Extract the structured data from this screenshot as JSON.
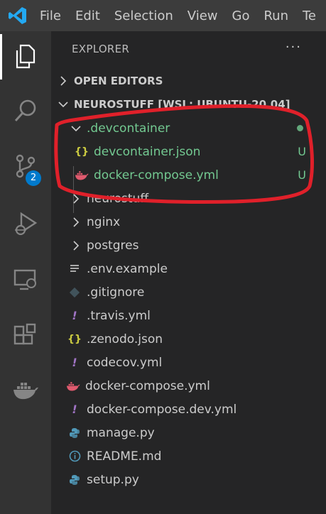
{
  "menu": [
    "File",
    "Edit",
    "Selection",
    "View",
    "Go",
    "Run",
    "Te"
  ],
  "activity": {
    "items": [
      "explorer-icon",
      "search-icon",
      "source-control-icon",
      "run-debug-icon",
      "remote-explorer-icon",
      "extensions-icon",
      "docker-icon"
    ],
    "scm_badge": "2"
  },
  "explorer": {
    "title": "EXPLORER",
    "more": "···",
    "open_editors": "OPEN EDITORS",
    "workspace": "NEUROSTUFF [WSL: UBUNTU-20.04]",
    "devcontainer": {
      "name": ".devcontainer",
      "children": [
        {
          "name": "devcontainer.json",
          "status": "U",
          "icon": "json-icon"
        },
        {
          "name": "docker-compose.yml",
          "status": "U",
          "icon": "docker-file-icon"
        }
      ]
    },
    "folders": [
      "neurostuff",
      "nginx",
      "postgres"
    ],
    "files": [
      {
        "name": ".env.example",
        "icon": "lines-icon"
      },
      {
        "name": ".gitignore",
        "icon": "git-icon"
      },
      {
        "name": ".travis.yml",
        "icon": "yaml-icon"
      },
      {
        "name": ".zenodo.json",
        "icon": "json-icon"
      },
      {
        "name": "codecov.yml",
        "icon": "yaml-icon"
      },
      {
        "name": "docker-compose.yml",
        "icon": "docker-file-icon"
      },
      {
        "name": "docker-compose.dev.yml",
        "icon": "yaml-icon"
      },
      {
        "name": "manage.py",
        "icon": "python-icon"
      },
      {
        "name": "README.md",
        "icon": "info-icon"
      },
      {
        "name": "setup.py",
        "icon": "python-icon"
      }
    ]
  },
  "colors": {
    "accent": "#007acc",
    "untracked": "#73c991",
    "annotation": "#e0202a"
  }
}
